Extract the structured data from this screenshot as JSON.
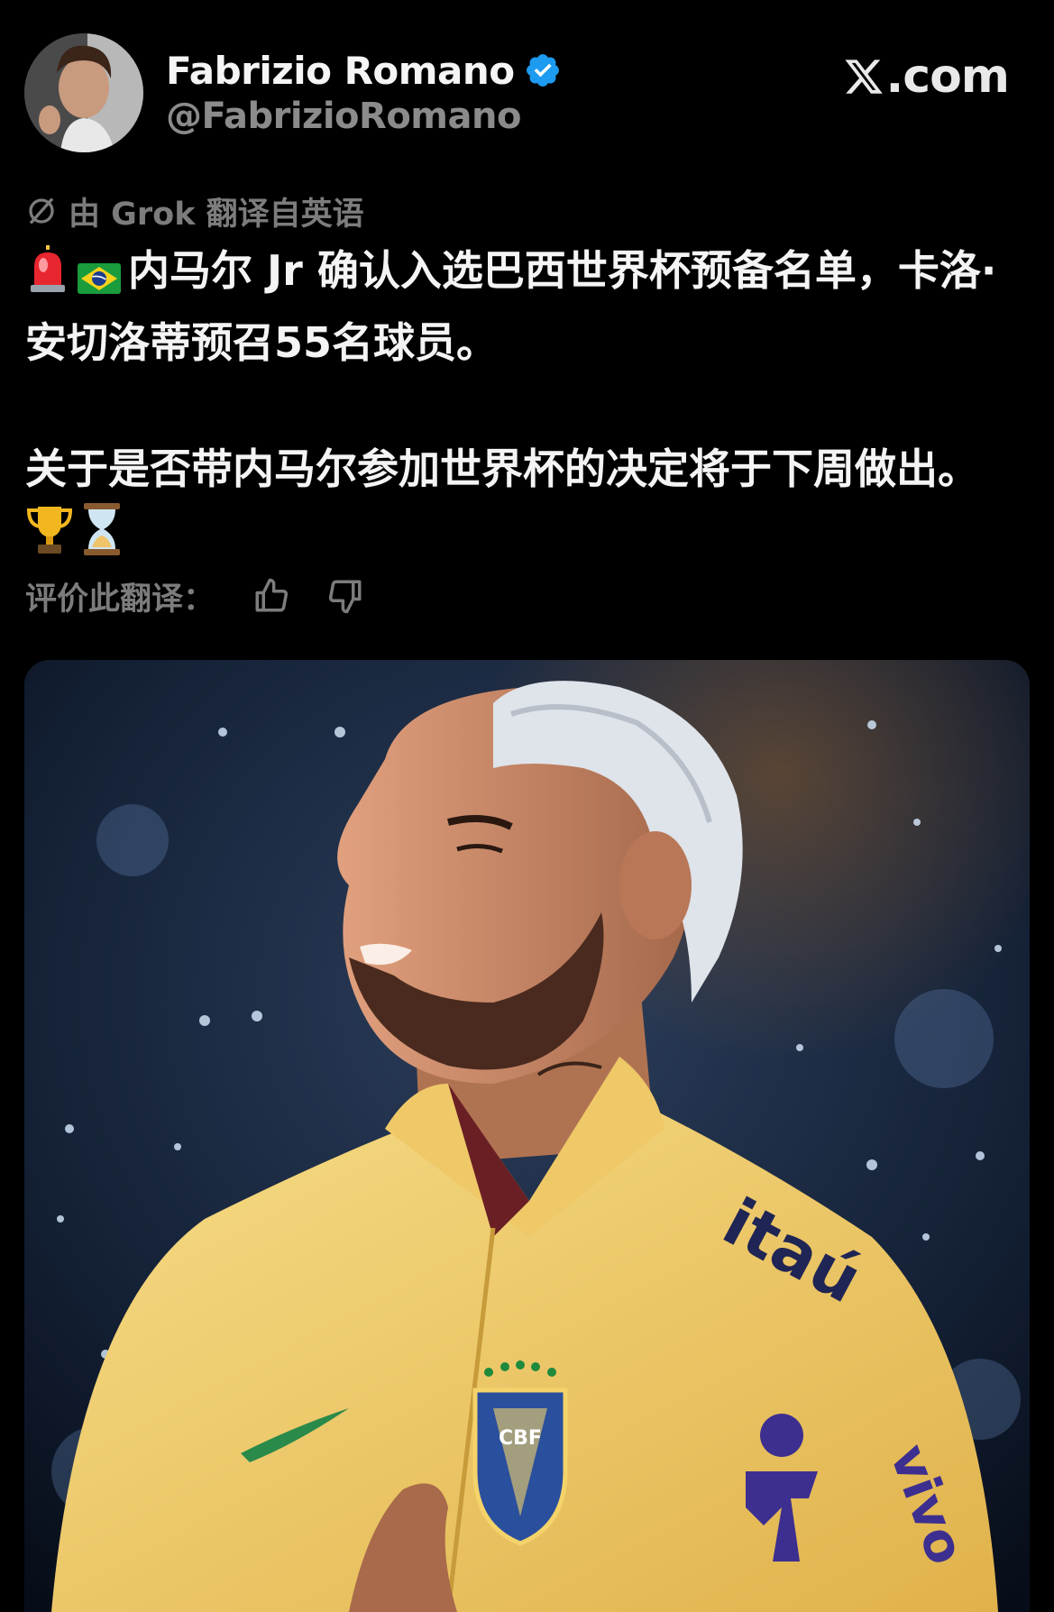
{
  "author": {
    "display_name": "Fabrizio Romano",
    "handle": "@FabrizioRomano",
    "verified": true,
    "avatar": "avatar-photo"
  },
  "site": {
    "logo_text": ".com",
    "logo_icon": "x-logo-icon"
  },
  "translation": {
    "note": "由 Grok 翻译自英语",
    "note_icon": "grok-icon"
  },
  "tweet": {
    "line1_emoji": [
      "🚨",
      "🇧🇷"
    ],
    "paragraph1": "内马尔 Jr 确认入选巴西世界杯预备名单，卡洛·安切洛蒂预召55名球员。",
    "paragraph2": "关于是否带内马尔参加世界杯的决定将于下周做出。",
    "paragraph2_emoji": [
      "🏆",
      "⏳"
    ]
  },
  "rate": {
    "label": "评价此翻译：",
    "like_icon": "thumbs-up-icon",
    "dislike_icon": "thumbs-down-icon"
  },
  "media": {
    "jersey_text_chest": "itaú",
    "badge_text": "CBF",
    "sleeve_text": "vivo"
  },
  "colors": {
    "background": "#000000",
    "verified_blue": "#1d9bf0",
    "muted_text": "#7c7c7c",
    "jersey_yellow": "#f3cf6a",
    "jersey_blue": "#3d2f8f"
  }
}
